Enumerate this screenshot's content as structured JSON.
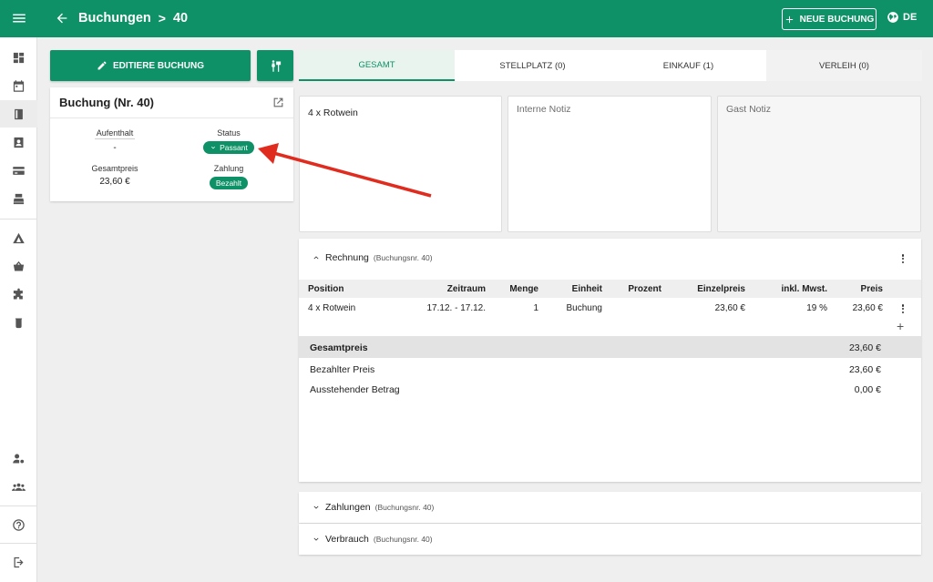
{
  "colors": {
    "brand": "#0e9166",
    "arrow": "#e02b1f"
  },
  "header": {
    "crumb_parent": "Buchungen",
    "crumb_separator": ">",
    "crumb_current": "40",
    "new_booking_label": "NEUE BUCHUNG",
    "language": "DE"
  },
  "sidebar": {
    "items": [
      {
        "icon": "dashboard-icon"
      },
      {
        "icon": "calendar-icon"
      },
      {
        "icon": "book-icon"
      },
      {
        "icon": "contact-card-icon"
      },
      {
        "icon": "credit-card-icon"
      },
      {
        "icon": "cash-register-icon"
      },
      {
        "icon": "tent-icon"
      },
      {
        "icon": "basket-icon"
      },
      {
        "icon": "puzzle-icon"
      },
      {
        "icon": "bin-icon"
      },
      {
        "icon": "user-settings-icon"
      },
      {
        "icon": "group-icon"
      },
      {
        "icon": "help-icon"
      },
      {
        "icon": "logout-icon"
      }
    ]
  },
  "actions": {
    "edit_label": "EDITIERE BUCHUNG"
  },
  "booking_card": {
    "title": "Buchung (Nr. 40)",
    "stay_label": "Aufenthalt",
    "stay_value": "-",
    "status_label": "Status",
    "status_value": "Passant",
    "total_label": "Gesamtpreis",
    "total_value": "23,60 €",
    "payment_label": "Zahlung",
    "payment_value": "Bezahlt"
  },
  "tabs": [
    {
      "label": "GESAMT",
      "active": true
    },
    {
      "label": "STELLPLATZ (0)"
    },
    {
      "label": "EINKAUF (1)"
    },
    {
      "label": "VERLEIH (0)"
    }
  ],
  "notes": {
    "summary": "4 x Rotwein",
    "internal_placeholder": "Interne Notiz",
    "guest_placeholder": "Gast Notiz"
  },
  "invoice": {
    "title": "Rechnung",
    "subtitle": "(Buchungsnr. 40)",
    "columns": [
      "Position",
      "Zeitraum",
      "Menge",
      "Einheit",
      "Prozent",
      "Einzelpreis",
      "inkl. Mwst.",
      "Preis"
    ],
    "rows": [
      {
        "position": "4 x Rotwein",
        "zeitraum": "17.12. - 17.12.",
        "menge": "1",
        "einheit": "Buchung",
        "prozent": "",
        "einzelpreis": "23,60 €",
        "mwst": "19 %",
        "preis": "23,60 €"
      }
    ],
    "add_symbol": "+",
    "total_label": "Gesamtpreis",
    "total_value": "23,60 €",
    "paid_label": "Bezahlter Preis",
    "paid_value": "23,60 €",
    "outstanding_label": "Ausstehender Betrag",
    "outstanding_value": "0,00 €"
  },
  "payments": {
    "title": "Zahlungen",
    "subtitle": "(Buchungsnr. 40)"
  },
  "consumption": {
    "title": "Verbrauch",
    "subtitle": "(Buchungsnr. 40)"
  }
}
